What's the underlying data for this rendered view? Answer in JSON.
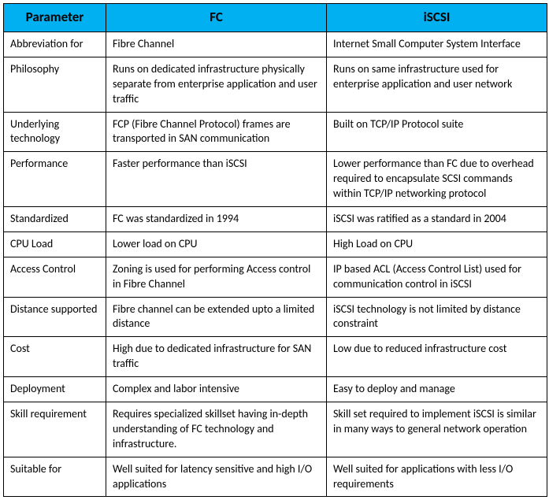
{
  "chart_data": {
    "type": "table",
    "headers": [
      "Parameter",
      "FC",
      "iSCSI"
    ],
    "rows": [
      {
        "param": "Abbreviation for",
        "fc": "Fibre Channel",
        "iscsi": "Internet Small Computer System Interface"
      },
      {
        "param": "Philosophy",
        "fc": "Runs on dedicated infrastructure physically separate from enterprise application and user traffic",
        "iscsi": "Runs on same infrastructure used for enterprise application and user network"
      },
      {
        "param": "Underlying technology",
        "fc": "FCP (Fibre Channel Protocol) frames are transported in SAN communication",
        "iscsi": "Built on TCP/IP Protocol suite"
      },
      {
        "param": "Performance",
        "fc": "Faster performance than iSCSI",
        "iscsi": "Lower performance than FC due to overhead required to encapsulate SCSI commands within TCP/IP networking protocol"
      },
      {
        "param": "Standardized",
        "fc": "FC was standardized in 1994",
        "iscsi": "iSCSI was ratified as a standard in 2004"
      },
      {
        "param": "CPU Load",
        "fc": "Lower load on CPU",
        "iscsi": "High Load on CPU"
      },
      {
        "param": "Access Control",
        "fc": "Zoning is used for performing Access control in Fibre Channel",
        "iscsi": "IP based ACL (Access Control List) used for communication control in iSCSI"
      },
      {
        "param": "Distance supported",
        "fc": "Fibre channel can be extended upto a limited distance",
        "iscsi": "iSCSI technology is not limited by distance constraint"
      },
      {
        "param": "Cost",
        "fc": "High due to dedicated infrastructure for SAN traffic",
        "iscsi": "Low due to reduced infrastructure cost"
      },
      {
        "param": "Deployment",
        "fc": "Complex and labor intensive",
        "iscsi": "Easy to deploy and manage"
      },
      {
        "param": "Skill requirement",
        "fc": "Requires specialized skillset having in-depth understanding of FC technology and infrastructure.",
        "iscsi": "Skill set required to implement iSCSI is similar in many ways to general network operation"
      },
      {
        "param": "Suitable for",
        "fc": "Well suited for latency sensitive and high I/O applications",
        "iscsi": "Well suited for applications with less I/O requirements"
      }
    ]
  }
}
